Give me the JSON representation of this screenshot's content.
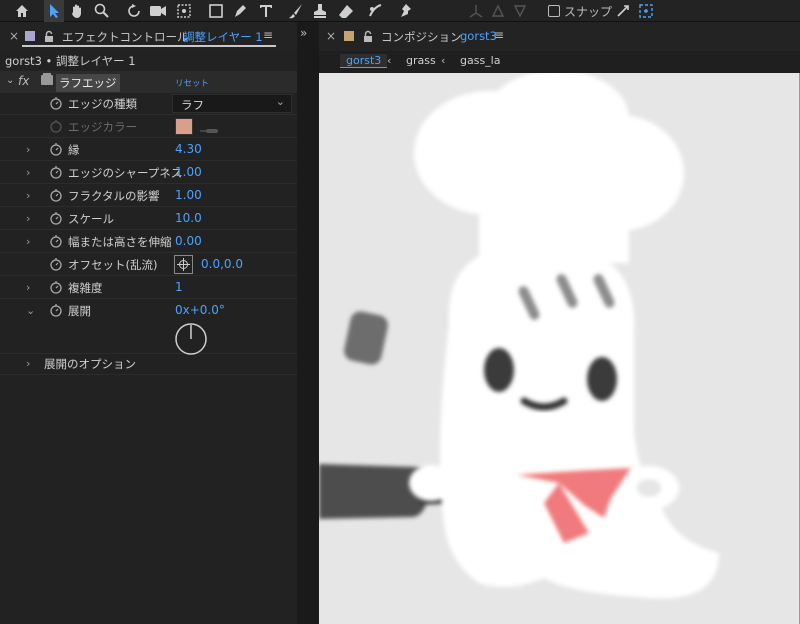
{
  "toolbar": {
    "tools": [
      "home-icon",
      "selection-arrow-icon",
      "hand-icon",
      "zoom-icon",
      "rotate-icon",
      "camera-icon",
      "pan-behind-icon",
      "rectangle-icon",
      "pen-icon",
      "type-icon",
      "brush-icon",
      "clone-stamp-icon",
      "eraser-icon",
      "roto-brush-icon",
      "puppet-pin-icon"
    ],
    "snap_label": "スナップ"
  },
  "effect_controls": {
    "tab_prefix": "エフェクトコントロール",
    "tab_layer": "調整レイヤー 1",
    "layer_line": "gorst3 • 調整レイヤー 1",
    "effect_name": "ラフエッジ",
    "reset_label": "リセット",
    "properties": [
      {
        "label": "エッジの種類",
        "value": "ラフ",
        "kind": "dropdown"
      },
      {
        "label": "エッジカラー",
        "value": "",
        "kind": "color",
        "color": "#d8a08a",
        "disabled": true
      },
      {
        "label": "縁",
        "value": "4.30",
        "kind": "number"
      },
      {
        "label": "エッジのシャープネス",
        "value": "1.00",
        "kind": "number"
      },
      {
        "label": "フラクタルの影響",
        "value": "1.00",
        "kind": "number"
      },
      {
        "label": "スケール",
        "value": "10.0",
        "kind": "number"
      },
      {
        "label": "幅または高さを伸縮",
        "value": "0.00",
        "kind": "number"
      },
      {
        "label": "オフセット(乱流)",
        "value": "0.0,0.0",
        "kind": "point"
      },
      {
        "label": "複雑度",
        "value": "1",
        "kind": "number"
      },
      {
        "label": "展開",
        "value": "0x+0.0°",
        "kind": "angle"
      },
      {
        "label": "展開のオプション",
        "value": "",
        "kind": "group"
      }
    ]
  },
  "composition": {
    "tab_prefix": "コンポジション",
    "tab_name": "gorst3",
    "subtabs": [
      "gorst3",
      "grass",
      "gass_la"
    ]
  },
  "colors": {
    "accent": "#4aa3ff",
    "panel_bg": "#222222",
    "canvas_bg": "#e6e6e6",
    "scarf": "#f07a7d"
  }
}
